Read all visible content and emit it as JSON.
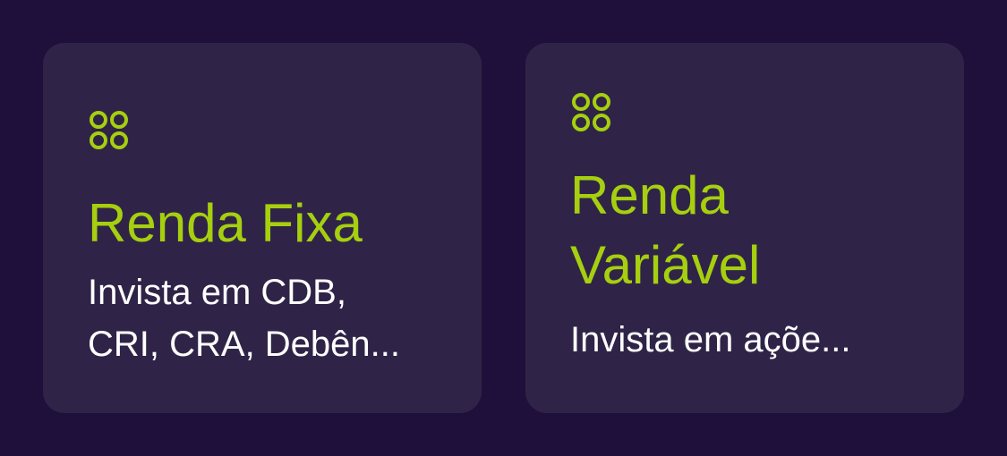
{
  "accent_color": "#a6cf0f",
  "background_color": "#1f0f3b",
  "card_color": "#2f2447",
  "cards": [
    {
      "icon": "grid-circles-icon",
      "title": "Renda Fixa",
      "description_line1": "Invista em CDB,",
      "description_line2": "CRI, CRA, Debên..."
    },
    {
      "icon": "grid-circles-icon",
      "title_line1": "Renda",
      "title_line2": "Variável",
      "description_line1": "Invista em açõe..."
    }
  ]
}
